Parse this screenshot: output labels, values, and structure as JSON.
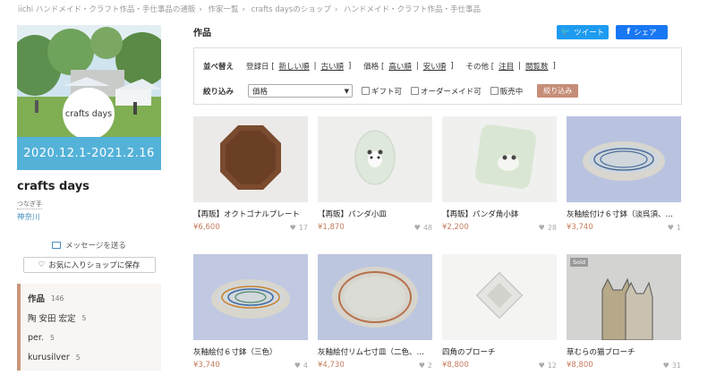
{
  "breadcrumb": [
    "iichi ハンドメイド・クラフト作品・手仕事品の通販",
    "作家一覧",
    "crafts daysのショップ",
    "ハンドメイド・クラフト作品・手仕事品"
  ],
  "sidebar": {
    "banner_circle_text": "crafts days",
    "banner_date": "2020.12.1-2021.2.16",
    "shop_name": "crafts days",
    "shop_tag": "つなぎ手",
    "shop_pref": "神奈川",
    "message_label": "メッセージを送る",
    "favorite_label": "お気に入りショップに保存",
    "categories": [
      {
        "label": "作品",
        "count": "146"
      },
      {
        "label": "陶 安田 宏定",
        "count": "5"
      },
      {
        "label": "per.",
        "count": "5"
      },
      {
        "label": "kurusilver",
        "count": "5"
      }
    ]
  },
  "main": {
    "title": "作品",
    "tweet_label": "ツイート",
    "share_label": "シェア",
    "filters": {
      "sort_label": "並べ替え",
      "reg_date_label": "登録日 [",
      "newest": "新しい順",
      "oldest": "古い順",
      "price_label": "価格 [",
      "high": "高い順",
      "low": "安い順",
      "other_label": "その他 [",
      "featured": "注目",
      "views": "閲覧数",
      "sep": "|",
      "close": "]",
      "narrow_label": "絞り込み",
      "select_value": "価格",
      "gift": "ギフト可",
      "order": "オーダーメイド可",
      "on_sale": "販売中",
      "apply": "絞り込み"
    },
    "items": [
      {
        "title": "【再販】オクトゴナルプレート",
        "price": "¥6,600",
        "likes": "17",
        "sold": ""
      },
      {
        "title": "【再販】パンダ小皿",
        "price": "¥1,870",
        "likes": "48",
        "sold": ""
      },
      {
        "title": "【再販】パンダ角小鉢",
        "price": "¥2,200",
        "likes": "28",
        "sold": ""
      },
      {
        "title": "灰釉絵付け６寸鉢（淡呉須、…",
        "price": "¥3,740",
        "likes": "1",
        "sold": ""
      },
      {
        "title": "灰釉絵付６寸鉢（三色）",
        "price": "¥3,740",
        "likes": "4",
        "sold": ""
      },
      {
        "title": "灰釉絵付リム七寸皿（二色、…",
        "price": "¥4,730",
        "likes": "2",
        "sold": ""
      },
      {
        "title": "四角のブローチ",
        "price": "¥8,800",
        "likes": "12",
        "sold": ""
      },
      {
        "title": "草むらの猫ブローチ",
        "price": "¥8,800",
        "likes": "31",
        "sold": "Sold"
      }
    ]
  },
  "colors": {
    "accent": "#c67c5e",
    "link": "#4a90c2",
    "twitter": "#1d9bf0",
    "facebook": "#1877f2",
    "banner": "#54b2d8"
  }
}
